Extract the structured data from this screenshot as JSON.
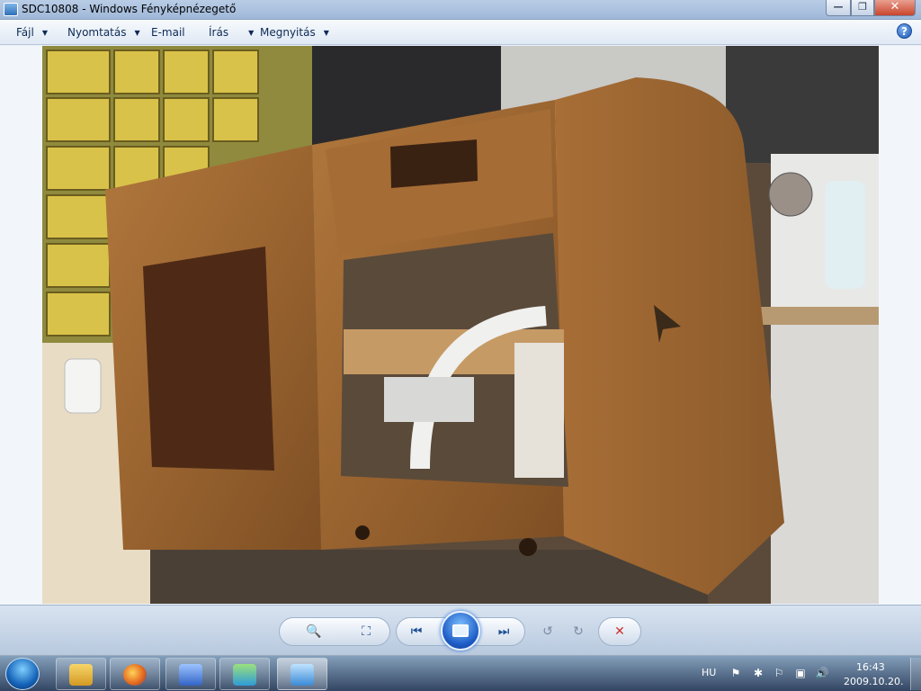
{
  "window": {
    "title": "SDC10808 - Windows Fényképnézegető",
    "minimize_glyph": "—",
    "maximize_glyph": "❐",
    "close_glyph": "✕"
  },
  "menu": {
    "items": [
      {
        "label": "Fájl"
      },
      {
        "label": "Nyomtatás"
      },
      {
        "label": "E-mail"
      },
      {
        "label": "Írás"
      },
      {
        "label": "Megnyitás"
      }
    ],
    "caret": "▼",
    "help_glyph": "?"
  },
  "controls": {
    "zoom_glyph": "🔍",
    "fit_glyph": "⛶",
    "prev_glyph": "⏮",
    "next_glyph": "⏭",
    "rotate_ccw_glyph": "↺",
    "rotate_cw_glyph": "↻",
    "delete_glyph": "✕"
  },
  "taskbar": {
    "language": "HU",
    "time": "16:43",
    "date": "2009.10.20."
  },
  "colors": {
    "accent": "#1d5cc6",
    "delete": "#d0302a"
  }
}
